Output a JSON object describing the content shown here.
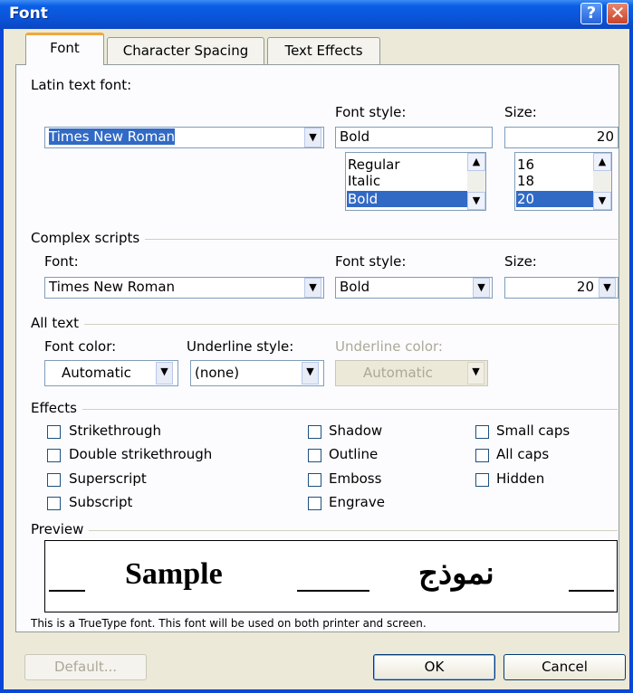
{
  "window": {
    "title": "Font",
    "help_glyph": "?",
    "close_glyph": "✕"
  },
  "tabs": [
    {
      "label": "Font",
      "active": true
    },
    {
      "label": "Character Spacing",
      "active": false
    },
    {
      "label": "Text Effects",
      "active": false
    }
  ],
  "latin": {
    "font_label": "Latin text font:",
    "font_value": "Times New Roman",
    "style_label": "Font style:",
    "style_value": "Bold",
    "style_options": [
      "Regular",
      "Italic",
      "Bold"
    ],
    "style_selected": "Bold",
    "size_label": "Size:",
    "size_value": "20",
    "size_options": [
      "16",
      "18",
      "20"
    ],
    "size_selected": "20"
  },
  "complex": {
    "group_label": "Complex scripts",
    "font_label": "Font:",
    "font_value": "Times New Roman",
    "style_label": "Font style:",
    "style_value": "Bold",
    "size_label": "Size:",
    "size_value": "20"
  },
  "all_text": {
    "group_label": "All text",
    "color_label": "Font color:",
    "color_value": "Automatic",
    "underline_label": "Underline style:",
    "underline_value": "(none)",
    "underline_color_label": "Underline color:",
    "underline_color_value": "Automatic"
  },
  "effects": {
    "group_label": "Effects",
    "items": [
      {
        "label": "Strikethrough",
        "checked": false
      },
      {
        "label": "Double strikethrough",
        "checked": false
      },
      {
        "label": "Superscript",
        "checked": false
      },
      {
        "label": "Subscript",
        "checked": false
      },
      {
        "label": "Shadow",
        "checked": false
      },
      {
        "label": "Outline",
        "checked": false
      },
      {
        "label": "Emboss",
        "checked": false
      },
      {
        "label": "Engrave",
        "checked": false
      },
      {
        "label": "Small caps",
        "checked": false
      },
      {
        "label": "All caps",
        "checked": false
      },
      {
        "label": "Hidden",
        "checked": false
      }
    ]
  },
  "preview": {
    "group_label": "Preview",
    "latin_sample": "Sample",
    "arabic_sample": "نموذج",
    "note": "This is a TrueType font. This font will be used on both printer and screen."
  },
  "buttons": {
    "default": "Default...",
    "ok": "OK",
    "cancel": "Cancel"
  },
  "colors": {
    "title_blue": "#0a5fe6",
    "selection": "#316ac5",
    "dialog_bg": "#ece9d8",
    "tab_accent": "#f1a83a"
  }
}
